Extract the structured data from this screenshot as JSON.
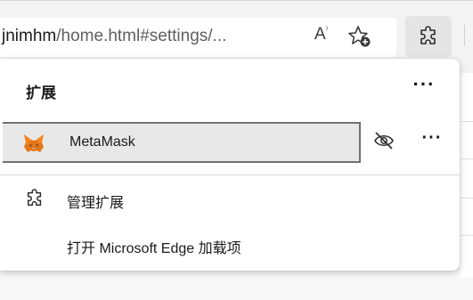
{
  "browser": {
    "url_host": "jnimhm",
    "url_rest": "/home.html#settings/...",
    "read_aloud_label": "A",
    "read_aloud_sup": "⁾",
    "favorites_icon": "star-add-icon",
    "extensions_icon": "puzzle-icon"
  },
  "panel": {
    "title": "扩展",
    "more_label": "···",
    "extension": {
      "name": "MetaMask",
      "icon": "fox-icon",
      "visibility_icon": "eye-off-icon",
      "more_label": "···"
    },
    "manage_label": "管理扩展",
    "open_addons_label": "打开 Microsoft Edge 加载项"
  },
  "colors": {
    "fox_orange": "#E2761B",
    "fox_dark": "#763D16",
    "selected_row_bg": "#E8E8E8",
    "selected_row_border": "#707070"
  }
}
